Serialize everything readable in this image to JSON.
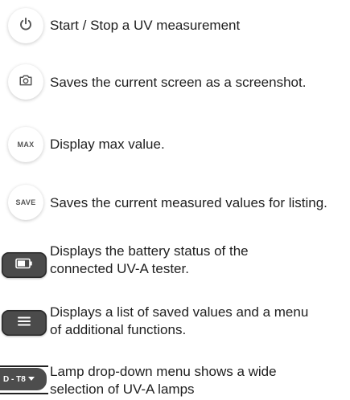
{
  "items": [
    {
      "icon": "power-icon",
      "description": "Start / Stop a UV measurement"
    },
    {
      "icon": "camera-icon",
      "description": "Saves the current screen as a screenshot."
    },
    {
      "icon": "max-text-icon",
      "button_text": "MAX",
      "description": "Display max value."
    },
    {
      "icon": "save-text-icon",
      "button_text": "SAVE",
      "description": "Saves the current measured values for listing."
    },
    {
      "icon": "battery-icon",
      "description_lines": [
        "Displays the battery status of the",
        "connected UV-A tester."
      ]
    },
    {
      "icon": "menu-icon",
      "description_lines": [
        "Displays a list of saved values and a menu",
        "of additional functions."
      ]
    },
    {
      "icon": "lamp-dropdown-icon",
      "button_text": "D - T8",
      "description_lines": [
        "Lamp drop-down menu shows a wide",
        "selection of UV-A lamps"
      ]
    }
  ],
  "colors": {
    "dark_button": "#4b4b4b",
    "icon_gray": "#555555"
  }
}
